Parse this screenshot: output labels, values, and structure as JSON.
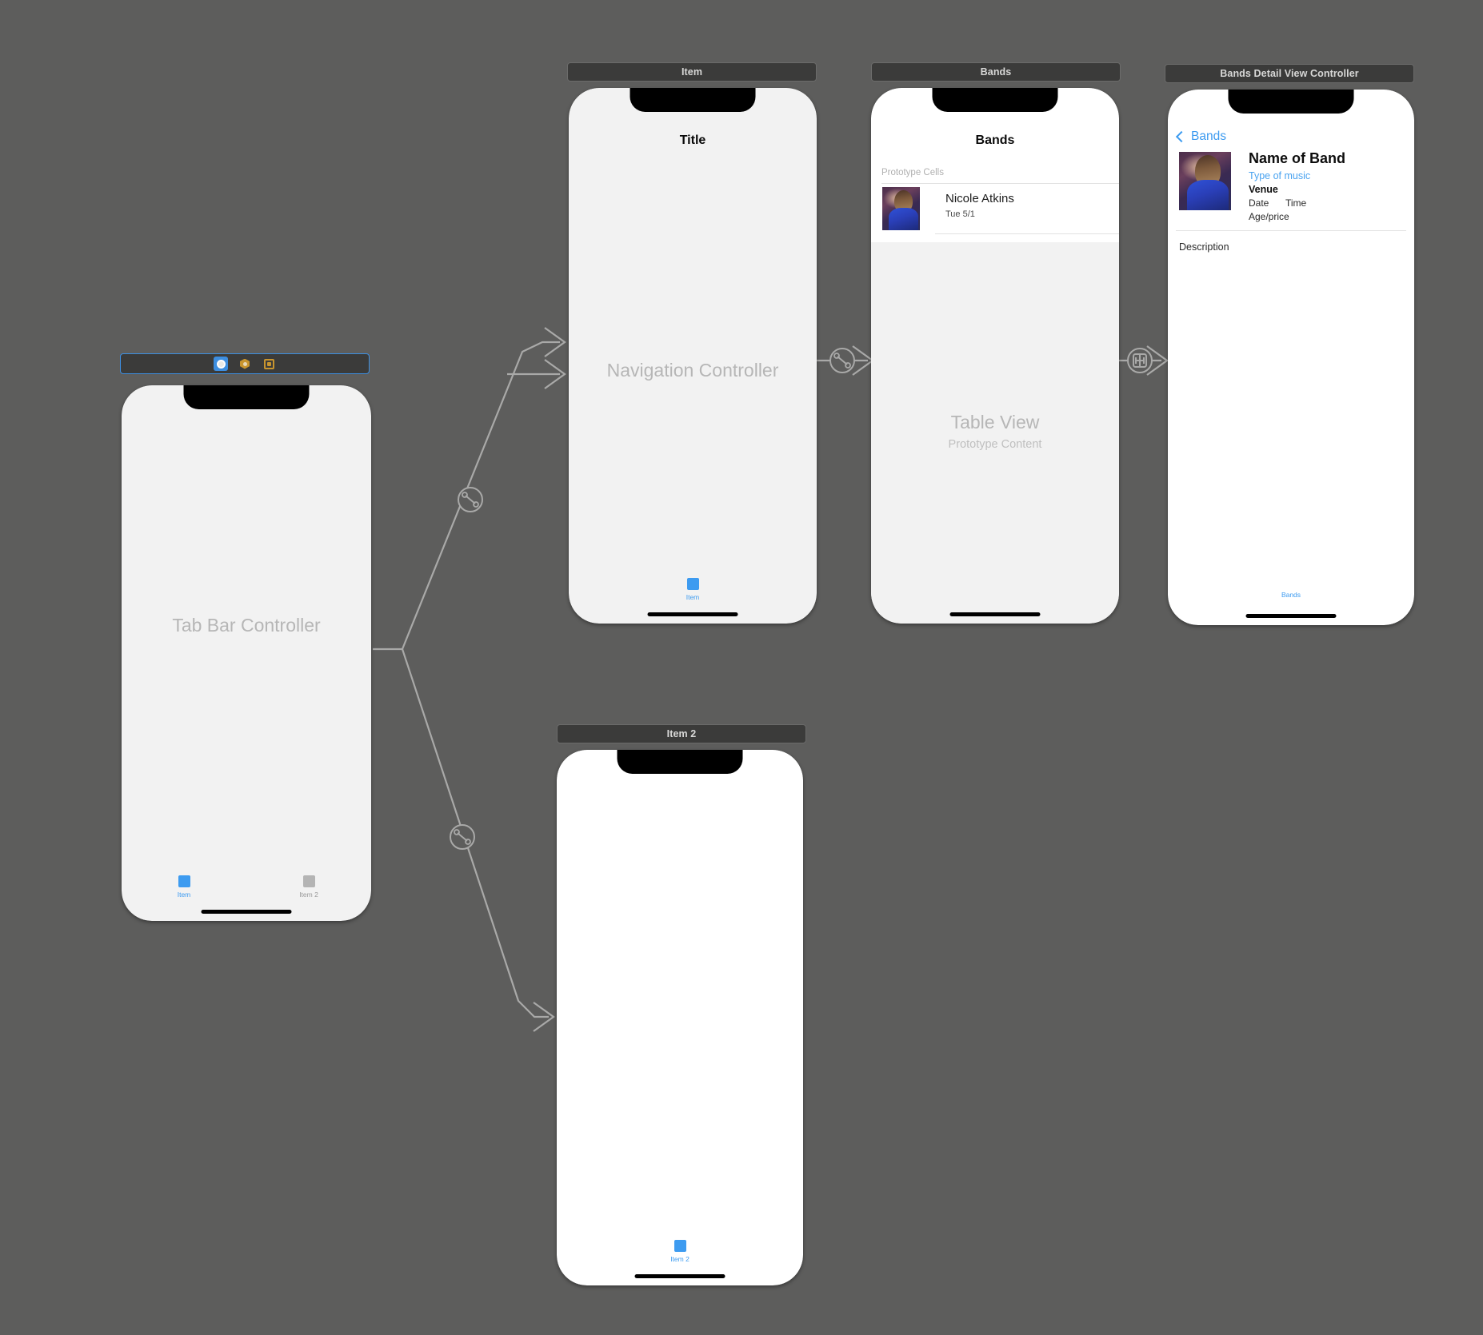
{
  "canvas": {
    "background": "#5d5d5c",
    "wire_color": "#a9a9a8"
  },
  "scenes": [
    {
      "id": "tab-bar-controller",
      "header": "",
      "dock": {
        "icons": [
          {
            "name": "view-controller-icon",
            "label": "View Controller",
            "selected": true
          },
          {
            "name": "first-responder-icon",
            "label": "First Responder",
            "selected": false
          },
          {
            "name": "exit-icon",
            "label": "Exit",
            "selected": false
          }
        ]
      },
      "placeholder": "Tab Bar Controller",
      "tabs": [
        {
          "label": "Item",
          "selected": true
        },
        {
          "label": "Item 2",
          "selected": false
        }
      ]
    },
    {
      "id": "navigation-controller",
      "header": "Item",
      "nav_title": "Title",
      "placeholder": "Navigation Controller",
      "tabs": [
        {
          "label": "Item",
          "selected": true
        }
      ]
    },
    {
      "id": "bands-table-view",
      "header": "Bands",
      "nav_title": "Bands",
      "section_header": "Prototype Cells",
      "cells": [
        {
          "title": "Nicole Atkins",
          "subtitle": "Tue 5/1",
          "thumbnail": "band-photo"
        }
      ],
      "placeholder": "Table View",
      "placeholder_sub": "Prototype Content"
    },
    {
      "id": "bands-detail-view-controller",
      "header": "Bands Detail View Controller",
      "back_button": "Bands",
      "band_name": "Name of Band",
      "music_type": "Type of music",
      "venue": "Venue",
      "date": "Date",
      "time": "Time",
      "age_price": "Age/price",
      "description": "Description",
      "bottom_tab_label": "Bands",
      "thumbnail": "band-photo"
    },
    {
      "id": "item2-view-controller",
      "header": "Item 2",
      "tabs": [
        {
          "label": "Item 2",
          "selected": true
        }
      ]
    }
  ],
  "segues": [
    {
      "name": "relationship-segue-nav",
      "type": "relationship",
      "icon": "relationship-icon"
    },
    {
      "name": "relationship-segue-item2",
      "type": "relationship",
      "icon": "relationship-icon"
    },
    {
      "name": "relationship-segue-root",
      "type": "relationship",
      "icon": "relationship-icon"
    },
    {
      "name": "show-segue-detail",
      "type": "show",
      "icon": "show-segue-icon"
    }
  ],
  "colors": {
    "accent_blue": "#3d9bf0",
    "selected_border": "#3d8ee0",
    "header_bar": "#3b3b3a",
    "canvas_bg": "#5d5d5c",
    "placeholder_text": "#b6b6b6"
  }
}
